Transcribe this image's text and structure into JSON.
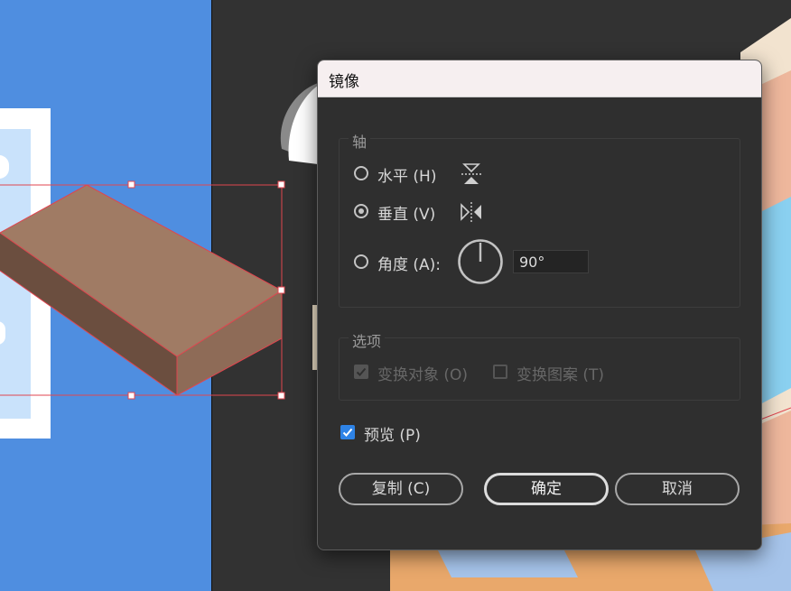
{
  "dialog": {
    "title": "镜像",
    "axis": {
      "legend": "轴",
      "horizontal_label": "水平 (H)",
      "vertical_label": "垂直 (V)",
      "angle_label": "角度 (A):",
      "angle_value": "90°",
      "selected": "vertical"
    },
    "options": {
      "legend": "选项",
      "transform_objects_label": "变换对象 (O)",
      "transform_objects_checked": true,
      "transform_patterns_label": "变换图案 (T)",
      "transform_patterns_checked": false
    },
    "preview_label": "预览 (P)",
    "preview_checked": true,
    "buttons": {
      "copy": "复制 (C)",
      "ok": "确定",
      "cancel": "取消"
    }
  },
  "colors": {
    "accent": "#2e83e6",
    "artboard_blue": "#4f8ee0",
    "selection": "#e0454f",
    "box_top": "#a07b64",
    "box_front": "#8e6b57",
    "box_side": "#6b4e3f"
  }
}
